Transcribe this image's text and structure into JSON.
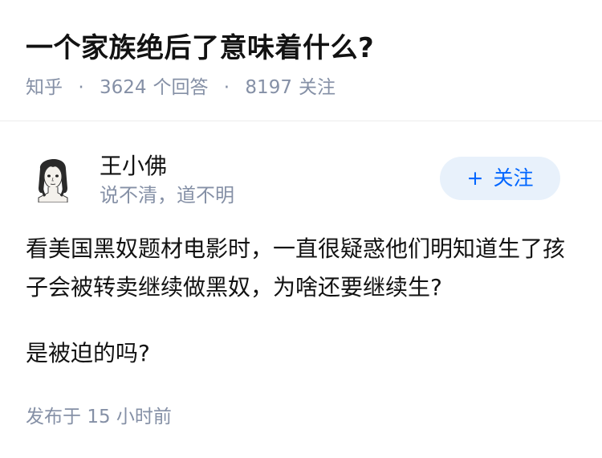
{
  "question": {
    "title": "一个家族绝后了意味着什么?",
    "source": "知乎",
    "separator": "·",
    "answer_count": "3624",
    "answer_label": "个回答",
    "follower_count": "8197",
    "follower_label": "关注"
  },
  "author": {
    "avatar_icon": "avatar-sketch-girl",
    "name": "王小佛",
    "bio": "说不清，道不明",
    "follow_plus": "+",
    "follow_label": "关注"
  },
  "body": {
    "paragraph_1": "看美国黑奴题材电影时，一直很疑惑他们明知道生了孩子会被转卖继续做黑奴，为啥还要继续生?",
    "paragraph_2": "是被迫的吗?"
  },
  "footer": {
    "published_label": "发布于",
    "published_time": "15 小时前"
  },
  "colors": {
    "primary_text": "#121212",
    "secondary_text": "#8590a6",
    "follow_bg": "#e8f1fb",
    "follow_text": "#0066ff",
    "divider": "#ebebeb"
  }
}
